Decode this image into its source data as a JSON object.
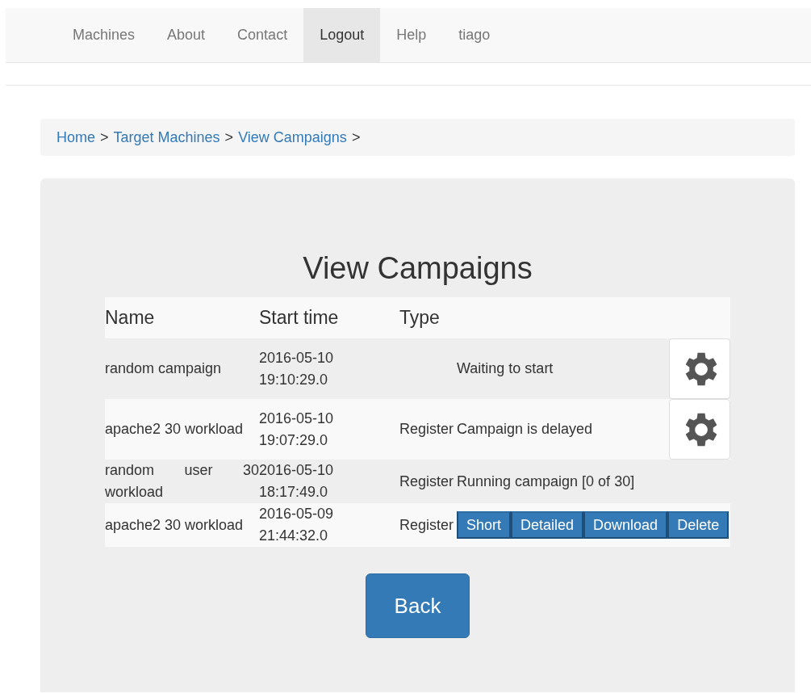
{
  "nav": {
    "items": [
      {
        "label": "Machines",
        "selected": false
      },
      {
        "label": "About",
        "selected": false
      },
      {
        "label": "Contact",
        "selected": false
      },
      {
        "label": "Logout",
        "selected": true
      },
      {
        "label": "Help",
        "selected": false
      },
      {
        "label": "tiago",
        "selected": false
      }
    ]
  },
  "breadcrumb": {
    "links": [
      "Home",
      "Target Machines",
      "View Campaigns"
    ],
    "separator": ">"
  },
  "title": "View Campaigns",
  "table": {
    "columns": [
      "Name",
      "Start time",
      "Type"
    ],
    "rows": [
      {
        "name": "random campaign",
        "start_time": "2016-05-10 19:10:29.0",
        "status": "Waiting to start",
        "control": {
          "kind": "gear"
        }
      },
      {
        "name": "apache2 30 workload",
        "start_time": "2016-05-10 19:07:29.0",
        "type": "Register",
        "status": "Campaign is delayed",
        "control": {
          "kind": "gear"
        }
      },
      {
        "name": "random user 30 workload",
        "start_time": "2016-05-10 18:17:49.0",
        "type": "Register",
        "status": "Running campaign [0 of 30]"
      },
      {
        "name": "apache2 30 workload",
        "start_time": "2016-05-09 21:44:32.0",
        "type": "Register",
        "control": {
          "kind": "buttons",
          "buttons": [
            "Short",
            "Detailed",
            "Download",
            "Delete"
          ]
        }
      }
    ]
  },
  "back_button": "Back"
}
